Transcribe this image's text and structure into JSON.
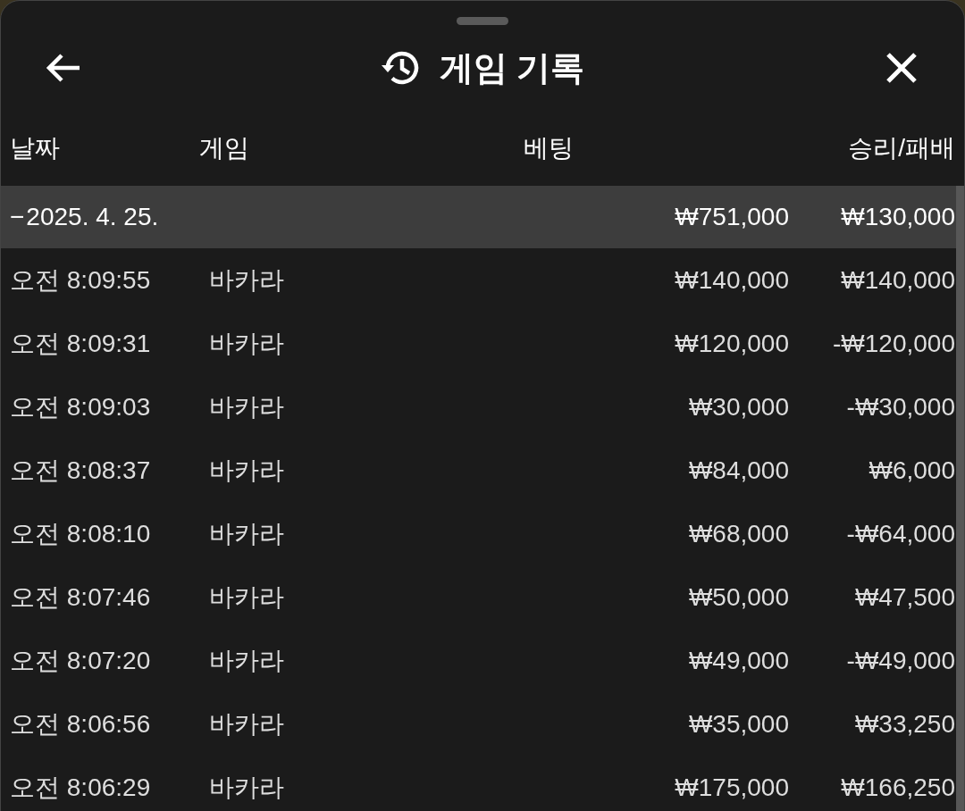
{
  "header": {
    "title": "게임 기록"
  },
  "table": {
    "columns": [
      "날짜",
      "게임",
      "베팅",
      "승리/패배"
    ],
    "groups": [
      {
        "toggle": "−",
        "date": "2025. 4. 25.",
        "bet": "₩751,000",
        "result": "₩130,000",
        "expanded": true,
        "rows": [
          {
            "time": "오전 8:09:55",
            "game": "바카라",
            "bet": "₩140,000",
            "result": "₩140,000"
          },
          {
            "time": "오전 8:09:31",
            "game": "바카라",
            "bet": "₩120,000",
            "result": "-₩120,000"
          },
          {
            "time": "오전 8:09:03",
            "game": "바카라",
            "bet": "₩30,000",
            "result": "-₩30,000"
          },
          {
            "time": "오전 8:08:37",
            "game": "바카라",
            "bet": "₩84,000",
            "result": "₩6,000"
          },
          {
            "time": "오전 8:08:10",
            "game": "바카라",
            "bet": "₩68,000",
            "result": "-₩64,000"
          },
          {
            "time": "오전 8:07:46",
            "game": "바카라",
            "bet": "₩50,000",
            "result": "₩47,500"
          },
          {
            "time": "오전 8:07:20",
            "game": "바카라",
            "bet": "₩49,000",
            "result": "-₩49,000"
          },
          {
            "time": "오전 8:06:56",
            "game": "바카라",
            "bet": "₩35,000",
            "result": "₩33,250"
          },
          {
            "time": "오전 8:06:29",
            "game": "바카라",
            "bet": "₩175,000",
            "result": "₩166,250"
          }
        ]
      }
    ]
  }
}
